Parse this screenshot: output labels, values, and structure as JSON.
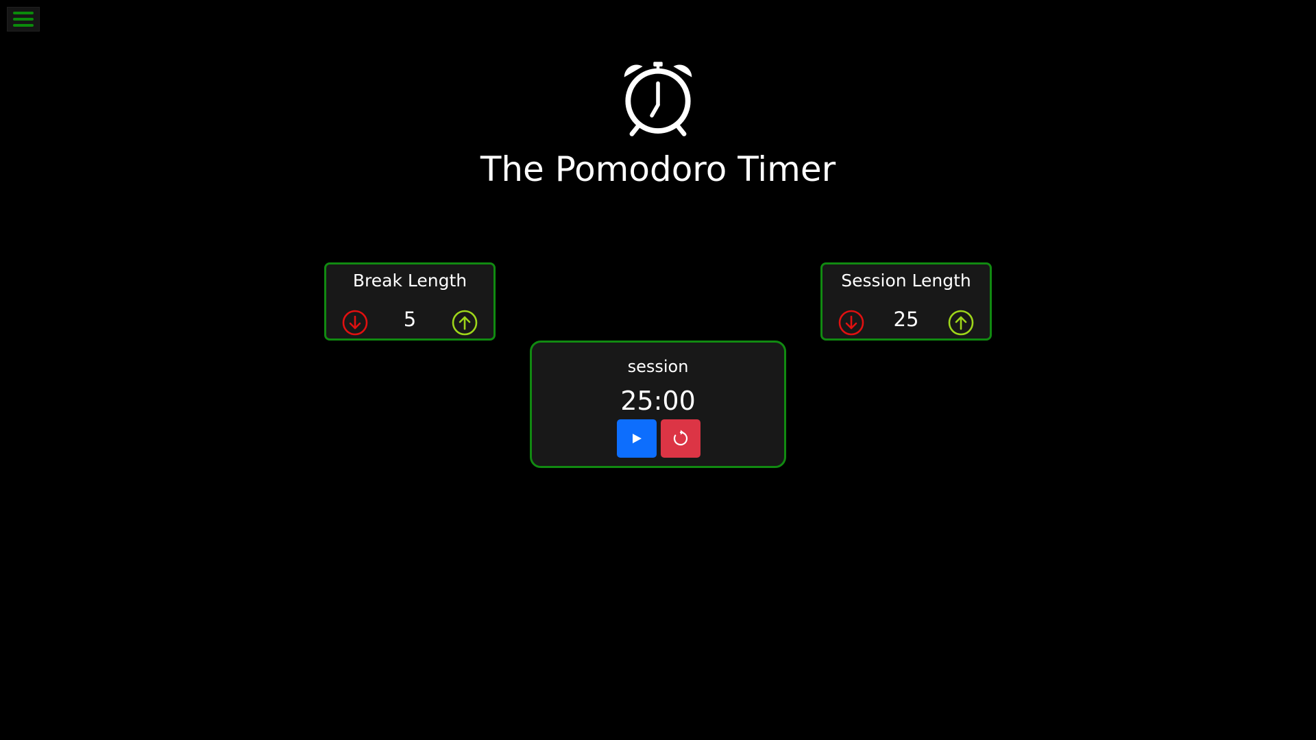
{
  "header": {
    "menu_icon": "hamburger-menu-icon",
    "app_icon": "alarm-clock-icon",
    "title": "The Pomodoro Timer"
  },
  "break": {
    "label": "Break Length",
    "value": "5",
    "decrement_icon": "arrow-down-circle-icon",
    "increment_icon": "arrow-up-circle-icon"
  },
  "session": {
    "label": "Session Length",
    "value": "25",
    "decrement_icon": "arrow-down-circle-icon",
    "increment_icon": "arrow-up-circle-icon"
  },
  "timer": {
    "label": "session",
    "time": "25:00",
    "play_icon": "play-icon",
    "reset_icon": "reset-icon"
  },
  "colors": {
    "background": "#000000",
    "card_border": "#118a11",
    "card_background": "#181818",
    "menu_bar": "#0b8a0b",
    "decrement": "#e01010",
    "increment": "#9ed61a",
    "play_button": "#0d6efd",
    "reset_button": "#dc3545"
  }
}
